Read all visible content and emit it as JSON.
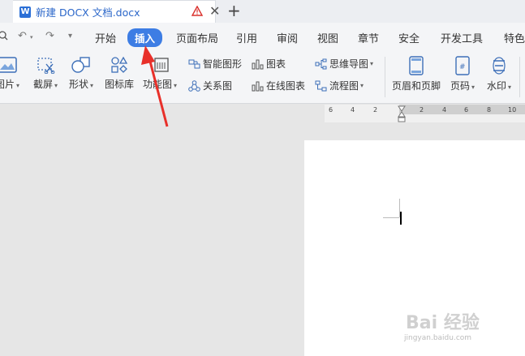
{
  "tab": {
    "title": "新建 DOCX 文档.docx",
    "app_icon": "W"
  },
  "menu": {
    "items": [
      "开始",
      "插入",
      "页面布局",
      "引用",
      "审阅",
      "视图",
      "章节",
      "安全",
      "开发工具",
      "特色"
    ],
    "active": "插入"
  },
  "ribbon": {
    "picture": "图片",
    "screenshot": "截屏",
    "shapes": "形状",
    "icon_library": "图标库",
    "function_chart": "功能图",
    "smart_shape": "智能图形",
    "chart": "图表",
    "mind_map": "思维导图",
    "relation_chart": "关系图",
    "online_chart": "在线图表",
    "flowchart": "流程图",
    "header_footer": "页眉和页脚",
    "page_number": "页码",
    "watermark": "水印"
  },
  "ruler": {
    "numbers": [
      "6",
      "4",
      "2",
      "2",
      "4",
      "6",
      "8",
      "10"
    ]
  },
  "watermark": {
    "text": "Bai 经验",
    "url": "jingyan.baidu.com"
  },
  "colors": {
    "accent": "#3d7de4",
    "arrow": "#e8302a",
    "tab_text": "#2a66c9"
  }
}
